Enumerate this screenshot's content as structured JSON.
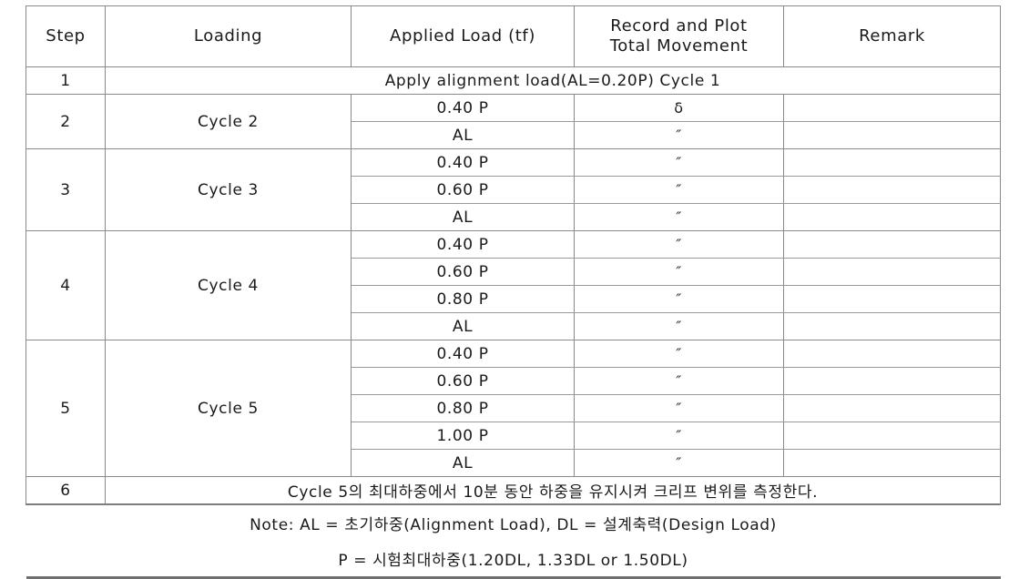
{
  "table": {
    "headers": [
      {
        "label": "Step",
        "name": "header-step"
      },
      {
        "label": "Loading",
        "name": "header-loading"
      },
      {
        "label": "Applied Load (tf)",
        "name": "header-applied-load"
      },
      {
        "label_line1": "Record and Plot",
        "label_line2": "Total Movement",
        "name": "header-record-plot"
      },
      {
        "label": "Remark",
        "name": "header-remark"
      }
    ],
    "steps": [
      {
        "step": "1",
        "span_text": "Apply alignment load(AL=0.20P) Cycle 1"
      },
      {
        "step": "2",
        "loading": "Cycle 2",
        "rows": [
          {
            "applied_load": "0.40 P",
            "movement": "δ",
            "remark": ""
          },
          {
            "applied_load": "AL",
            "movement": "″",
            "remark": ""
          }
        ]
      },
      {
        "step": "3",
        "loading": "Cycle 3",
        "rows": [
          {
            "applied_load": "0.40 P",
            "movement": "″",
            "remark": ""
          },
          {
            "applied_load": "0.60 P",
            "movement": "″",
            "remark": ""
          },
          {
            "applied_load": "AL",
            "movement": "″",
            "remark": ""
          }
        ]
      },
      {
        "step": "4",
        "loading": "Cycle 4",
        "rows": [
          {
            "applied_load": "0.40 P",
            "movement": "″",
            "remark": ""
          },
          {
            "applied_load": "0.60 P",
            "movement": "″",
            "remark": ""
          },
          {
            "applied_load": "0.80 P",
            "movement": "″",
            "remark": ""
          },
          {
            "applied_load": "AL",
            "movement": "″",
            "remark": ""
          }
        ]
      },
      {
        "step": "5",
        "loading": "Cycle 5",
        "rows": [
          {
            "applied_load": "0.40 P",
            "movement": "″",
            "remark": ""
          },
          {
            "applied_load": "0.60 P",
            "movement": "″",
            "remark": ""
          },
          {
            "applied_load": "0.80 P",
            "movement": "″",
            "remark": ""
          },
          {
            "applied_load": "1.00 P",
            "movement": "″",
            "remark": ""
          },
          {
            "applied_load": "AL",
            "movement": "″",
            "remark": ""
          }
        ]
      },
      {
        "step": "6",
        "span_text": "Cycle 5의 최대하중에서 10분 동안 하중을 유지시켜 크리프 변위를 측정한다."
      }
    ],
    "notes": [
      "Note: AL = 초기하중(Alignment Load), DL = 설계축력(Design Load)",
      "P = 시험최대하중(1.20DL, 1.33DL or 1.50DL)"
    ]
  },
  "colors": {
    "header_background": "#d6d6d6",
    "border": "#7d7d7d",
    "outer_border": "#6f6f6f",
    "text": "#1a1a1a",
    "page_background": "#ffffff"
  }
}
